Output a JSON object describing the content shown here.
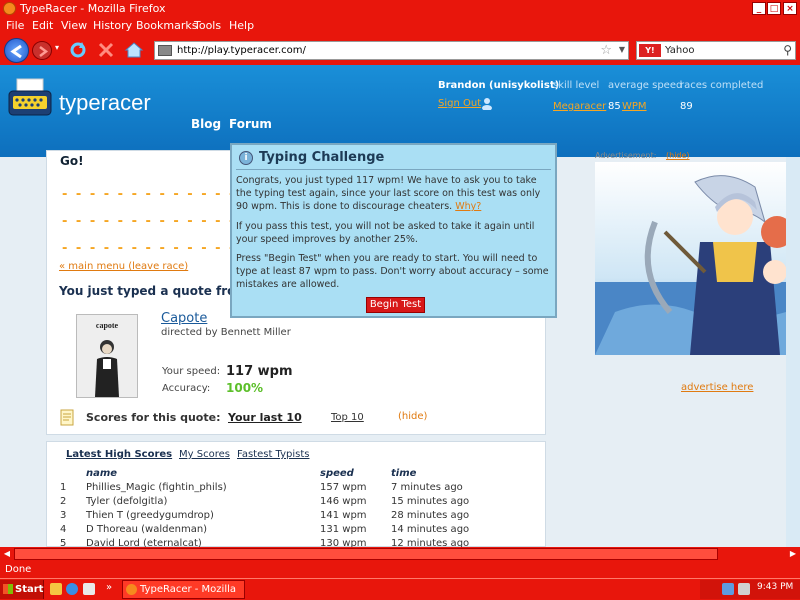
{
  "window": {
    "title": "TypeRacer - Mozilla Firefox"
  },
  "menu": [
    "File",
    "Edit",
    "View",
    "History",
    "Bookmarks",
    "Tools",
    "Help"
  ],
  "browser": {
    "url": "http://play.typeracer.com/",
    "search_engine": "Yahoo",
    "search_engine_icon": "Y!"
  },
  "site": {
    "logo": "typeracer",
    "nav": {
      "blog": "Blog",
      "forum": "Forum"
    },
    "user": {
      "name": "Brandon (unisykolist)",
      "sign_out": "Sign Out",
      "skill_label": "skill level",
      "skill_value": "Megaracer",
      "speed_label": "average speed",
      "speed_value": "85",
      "speed_unit": "WPM",
      "races_label": "races completed",
      "races_value": "89"
    }
  },
  "race": {
    "go": "Go!",
    "main_menu_link": "« main menu (leave race)",
    "typed_heading": "You just typed a quote fro",
    "poster_title": "capote",
    "movie_title": "Capote",
    "movie_director": "directed by Bennett Miller",
    "speed_label": "Your speed:",
    "speed_value": "117 wpm",
    "accuracy_label": "Accuracy:",
    "accuracy_value": "100%",
    "scores_label": "Scores for this quote:",
    "scores_last10": "Your last 10",
    "scores_top10": "Top 10",
    "scores_hide": "(hide)"
  },
  "high_scores": {
    "tabs": [
      "Latest High Scores",
      "My Scores",
      "Fastest Typists"
    ],
    "columns": {
      "name": "name",
      "speed": "speed",
      "time": "time"
    },
    "rows": [
      {
        "rank": "1",
        "name": "Phillies_Magic (fightin_phils)",
        "speed": "157 wpm",
        "time": "7 minutes ago"
      },
      {
        "rank": "2",
        "name": "Tyler (defolgitla)",
        "speed": "146 wpm",
        "time": "15 minutes ago"
      },
      {
        "rank": "3",
        "name": "Thien T (greedygumdrop)",
        "speed": "141 wpm",
        "time": "28 minutes ago"
      },
      {
        "rank": "4",
        "name": "D Thoreau (waldenman)",
        "speed": "131 wpm",
        "time": "14 minutes ago"
      },
      {
        "rank": "5",
        "name": "David Lord (eternalcat)",
        "speed": "130 wpm",
        "time": "12 minutes ago"
      }
    ]
  },
  "ad": {
    "label": "Advertisement:",
    "hide": "(hide)",
    "advertise_link": "advertise here"
  },
  "modal": {
    "title": "Typing Challenge",
    "p1": "Congrats, you just typed 117 wpm! We have to ask you to take the typing test again, since your last score on this test was only 90 wpm. This is done to discourage cheaters.",
    "why": "Why?",
    "p2": "If you pass this test, you will not be asked to take it again until your speed improves by another 25%.",
    "p3": "Press \"Begin Test\" when you are ready to start. You will need to type at least 87 wpm to pass. Don't worry about accuracy – some mistakes are allowed.",
    "button": "Begin Test"
  },
  "status": "Done",
  "taskbar": {
    "start": "Start",
    "task": "TypeRacer - Mozilla Fi...",
    "clock": "9:43 PM"
  },
  "colors": {
    "chrome": "#e8160c",
    "header": "#1a8fd8",
    "accent": "#f5a623",
    "modal_bg": "#aadff4"
  }
}
